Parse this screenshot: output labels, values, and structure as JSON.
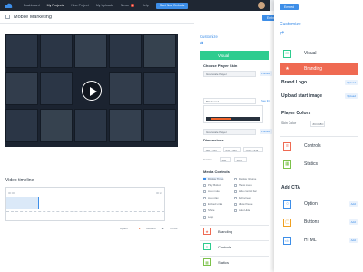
{
  "topnav": {
    "items": [
      "Dashboard",
      "My Projects",
      "New Project",
      "My Uploads",
      "News",
      "Help"
    ],
    "news_badge": "3",
    "go_pro": "Start Now Embeds"
  },
  "main": {
    "title": "Mobile Marketing",
    "embed_label": "Embed",
    "timeline_label": "Video timeline",
    "timeline_start": "00:00",
    "timeline_end": "00:24",
    "legend": [
      "Option",
      "Buttons",
      "HTML"
    ]
  },
  "middle": {
    "customize": "Customize",
    "visual": "Visual",
    "choose_skin": "Choose Player Skin",
    "skin1": "Greyscale Player",
    "preview": "Preview",
    "skin2": "Blackened",
    "see_all": "See this",
    "skin3": "Greyscale Player",
    "dimensions": "Dimensions",
    "dim_opts": [
      "480 x 270",
      "640 x 360",
      "1024 x 576"
    ],
    "custom_label": "Custom",
    "custom_w": "480",
    "custom_h": "1024",
    "media_controls": "Media Controls",
    "controls_left": [
      "Display Times",
      "Play Button",
      "Auto mute",
      "Auto play",
      "Embed Links",
      "Share",
      "Loop"
    ],
    "controls_right": [
      "Display Volume",
      "Show menu",
      "Hide control bar",
      "Full screen",
      "Allow Pause",
      "Auto Hide"
    ],
    "list": [
      "Branding",
      "Controls",
      "Statics"
    ]
  },
  "right": {
    "embed_label": "Embed",
    "customize": "Customize",
    "visual": "Visual",
    "branding": "Branding",
    "brand_logo": "Brand Logo",
    "upload_start": "Upload start image",
    "upload": "Upload",
    "player_colors": "Player Colors",
    "skin_color_label": "Skin Color",
    "skin_color_value": "#CCC8C",
    "controls": "Controls",
    "statics": "Statics",
    "add_cta": "Add CTA",
    "cta": [
      "Option",
      "Buttons",
      "HTML"
    ],
    "add": "Add"
  },
  "colors": {
    "accent": "#3d8ee8",
    "visual_green": "#2ecc8f",
    "branding_red": "#ef6a52",
    "nav_dark": "#1f2733"
  }
}
